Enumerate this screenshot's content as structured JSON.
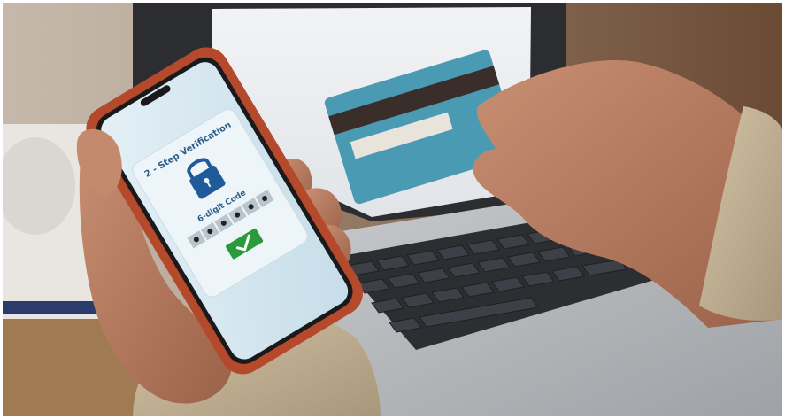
{
  "photo": {
    "subject": "phone-two-step-verification",
    "screen": {
      "heading": "2 - Step Verification",
      "code_label": "6-digit Code",
      "code_digits": 6,
      "icons": [
        "lock-icon",
        "check-icon"
      ]
    },
    "colors": {
      "phone_case": "#b4492c",
      "screen_bg": "#d9e9f1",
      "card_bg": "#4b9ab3",
      "accent_blue": "#1f5a9a",
      "confirm_green": "#2a9b3a"
    }
  }
}
